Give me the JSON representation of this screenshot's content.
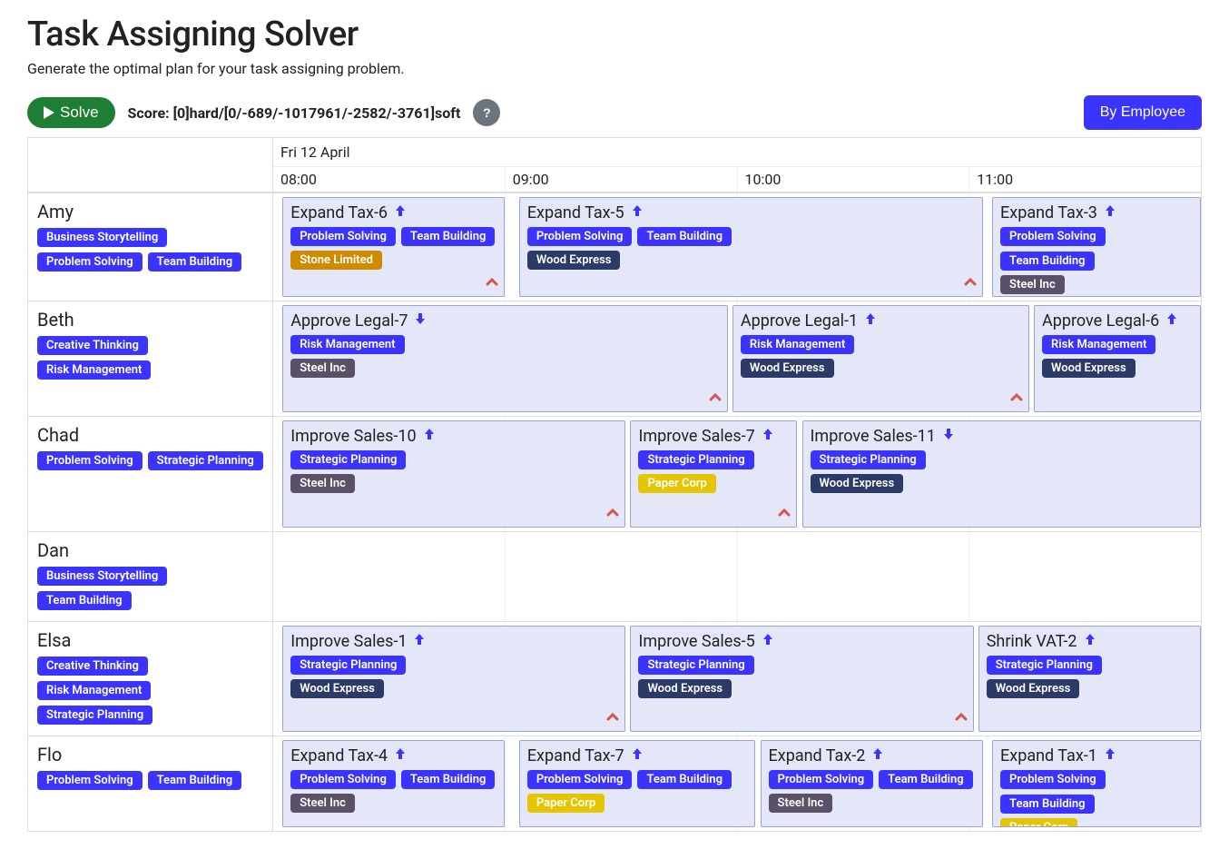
{
  "header": {
    "title": "Task Assigning Solver",
    "subtitle": "Generate the optimal plan for your task assigning problem.",
    "solve_label": "Solve",
    "score_label": "Score: [0]hard/[0/-689/-1017961/-2582/-3761]soft",
    "help_label": "?",
    "view_toggle_label": "By Employee"
  },
  "timeline": {
    "date_label": "Fri 12 April",
    "hours": [
      "08:00",
      "09:00",
      "10:00",
      "11:00"
    ]
  },
  "colors": {
    "skill": "#3b33ff",
    "companies": {
      "Stone Limited": "#d08a00",
      "Wood Express": "#2b3a67",
      "Steel Inc": "#5a5168",
      "Paper Corp": "#e4c600"
    },
    "priority_up": "#3b33ff",
    "priority_down": "#3b33ff",
    "chevron": "#d9534f"
  },
  "employees": [
    {
      "name": "Amy",
      "skills": [
        "Business Storytelling",
        "Problem Solving",
        "Team Building"
      ],
      "lane_height": 118,
      "tasks": [
        {
          "title": "Expand Tax-6",
          "priority": "up",
          "skills": [
            "Problem Solving",
            "Team Building"
          ],
          "company": "Stone Limited",
          "start_pct": 1,
          "width_pct": 24,
          "chevron": true
        },
        {
          "title": "Expand Tax-5",
          "priority": "up",
          "skills": [
            "Problem Solving",
            "Team Building"
          ],
          "company": "Wood Express",
          "start_pct": 26.5,
          "width_pct": 50,
          "chevron": true
        },
        {
          "title": "Expand Tax-3",
          "priority": "up",
          "skills": [
            "Problem Solving",
            "Team Building"
          ],
          "company": "Steel Inc",
          "start_pct": 77.5,
          "width_pct": 22.5,
          "chevron": false
        }
      ]
    },
    {
      "name": "Beth",
      "skills": [
        "Creative Thinking",
        "Risk Management"
      ],
      "lane_height": 126,
      "tasks": [
        {
          "title": "Approve Legal-7",
          "priority": "down",
          "skills": [
            "Risk Management"
          ],
          "company": "Steel Inc",
          "start_pct": 1,
          "width_pct": 48,
          "chevron": true
        },
        {
          "title": "Approve Legal-1",
          "priority": "up",
          "skills": [
            "Risk Management"
          ],
          "company": "Wood Express",
          "start_pct": 49.5,
          "width_pct": 32,
          "chevron": true
        },
        {
          "title": "Approve Legal-6",
          "priority": "up",
          "skills": [
            "Risk Management"
          ],
          "company": "Wood Express",
          "start_pct": 82,
          "width_pct": 18,
          "chevron": false
        }
      ]
    },
    {
      "name": "Chad",
      "skills": [
        "Problem Solving",
        "Strategic Planning"
      ],
      "lane_height": 126,
      "tasks": [
        {
          "title": "Improve Sales-10",
          "priority": "up",
          "skills": [
            "Strategic Planning"
          ],
          "company": "Steel Inc",
          "start_pct": 1,
          "width_pct": 37,
          "chevron": true
        },
        {
          "title": "Improve Sales-7",
          "priority": "up",
          "skills": [
            "Strategic Planning"
          ],
          "company": "Paper Corp",
          "start_pct": 38.5,
          "width_pct": 18,
          "chevron": true
        },
        {
          "title": "Improve Sales-11",
          "priority": "down",
          "skills": [
            "Strategic Planning"
          ],
          "company": "Wood Express",
          "start_pct": 57,
          "width_pct": 43,
          "chevron": false
        }
      ]
    },
    {
      "name": "Dan",
      "skills": [
        "Business Storytelling",
        "Team Building"
      ],
      "lane_height": 66,
      "tasks": []
    },
    {
      "name": "Elsa",
      "skills": [
        "Creative Thinking",
        "Risk Management",
        "Strategic Planning"
      ],
      "lane_height": 120,
      "tasks": [
        {
          "title": "Improve Sales-1",
          "priority": "up",
          "skills": [
            "Strategic Planning"
          ],
          "company": "Wood Express",
          "start_pct": 1,
          "width_pct": 37,
          "chevron": true
        },
        {
          "title": "Improve Sales-5",
          "priority": "up",
          "skills": [
            "Strategic Planning"
          ],
          "company": "Wood Express",
          "start_pct": 38.5,
          "width_pct": 37,
          "chevron": true
        },
        {
          "title": "Shrink VAT-2",
          "priority": "up",
          "skills": [
            "Strategic Planning"
          ],
          "company": "Wood Express",
          "start_pct": 76,
          "width_pct": 24,
          "chevron": false
        }
      ]
    },
    {
      "name": "Flo",
      "skills": [
        "Problem Solving",
        "Team Building"
      ],
      "lane_height": 104,
      "tasks": [
        {
          "title": "Expand Tax-4",
          "priority": "up",
          "skills": [
            "Problem Solving",
            "Team Building"
          ],
          "company": "Steel Inc",
          "start_pct": 1,
          "width_pct": 24,
          "chevron": false
        },
        {
          "title": "Expand Tax-7",
          "priority": "up",
          "skills": [
            "Problem Solving",
            "Team Building"
          ],
          "company": "Paper Corp",
          "start_pct": 26.5,
          "width_pct": 25.5,
          "chevron": false
        },
        {
          "title": "Expand Tax-2",
          "priority": "up",
          "skills": [
            "Problem Solving",
            "Team Building"
          ],
          "company": "Steel Inc",
          "start_pct": 52.5,
          "width_pct": 24,
          "chevron": false
        },
        {
          "title": "Expand Tax-1",
          "priority": "up",
          "skills": [
            "Problem Solving",
            "Team Building"
          ],
          "company": "Paper Corp",
          "start_pct": 77.5,
          "width_pct": 22.5,
          "chevron": false
        }
      ]
    }
  ]
}
